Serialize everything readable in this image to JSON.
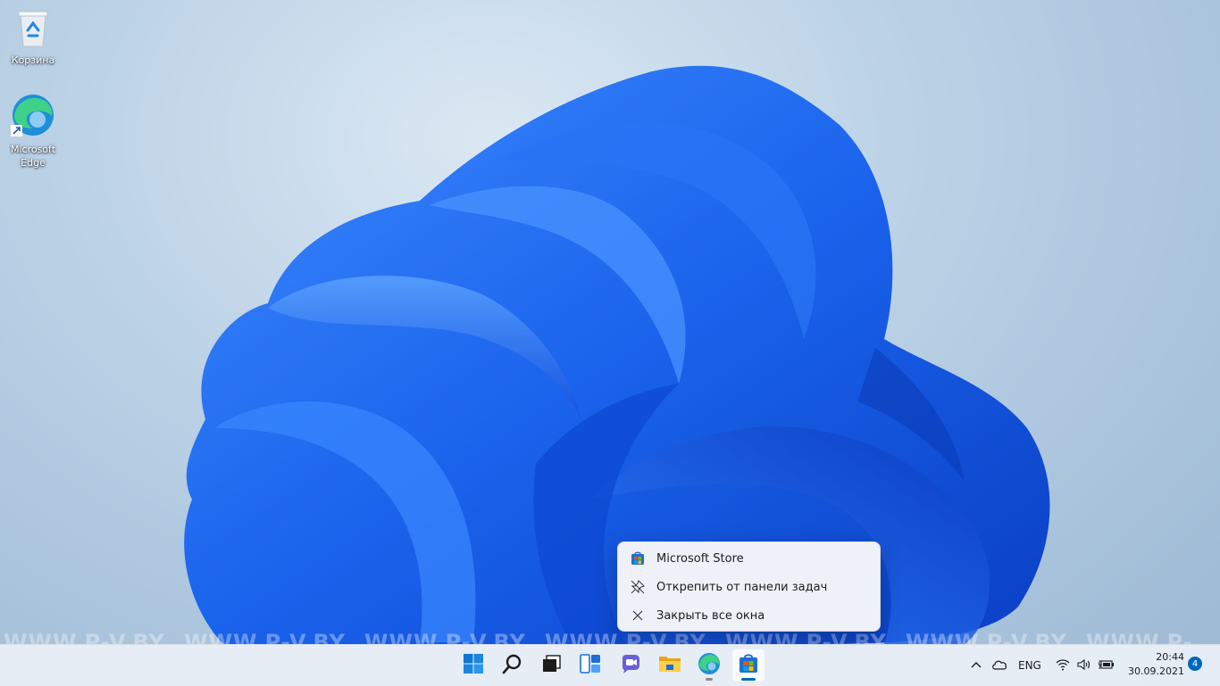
{
  "desktop": {
    "icons": [
      {
        "label": "Корзина",
        "icon": "recycle-bin-icon"
      },
      {
        "label": "Microsoft Edge",
        "icon": "edge-icon"
      }
    ]
  },
  "watermark": {
    "text": "WWW.P-V.BY"
  },
  "context_menu": {
    "items": [
      {
        "label": "Microsoft Store",
        "icon": "store-icon"
      },
      {
        "label": "Открепить от панели задач",
        "icon": "unpin-icon"
      },
      {
        "label": "Закрыть все окна",
        "icon": "close-icon"
      }
    ]
  },
  "taskbar": {
    "apps": [
      {
        "name": "Start",
        "icon": "windows-start-icon"
      },
      {
        "name": "Search",
        "icon": "search-icon"
      },
      {
        "name": "Task View",
        "icon": "task-view-icon"
      },
      {
        "name": "Widgets",
        "icon": "widgets-icon"
      },
      {
        "name": "Chat",
        "icon": "chat-icon"
      },
      {
        "name": "File Explorer",
        "icon": "folder-icon"
      },
      {
        "name": "Microsoft Edge",
        "icon": "edge-icon"
      },
      {
        "name": "Microsoft Store",
        "icon": "store-icon"
      }
    ],
    "tray": {
      "language": "ENG",
      "time": "20:44",
      "date": "30.09.2021",
      "notifications": "4"
    }
  },
  "colors": {
    "accent": "#0067c0",
    "bloom": "#1a6cf0"
  }
}
